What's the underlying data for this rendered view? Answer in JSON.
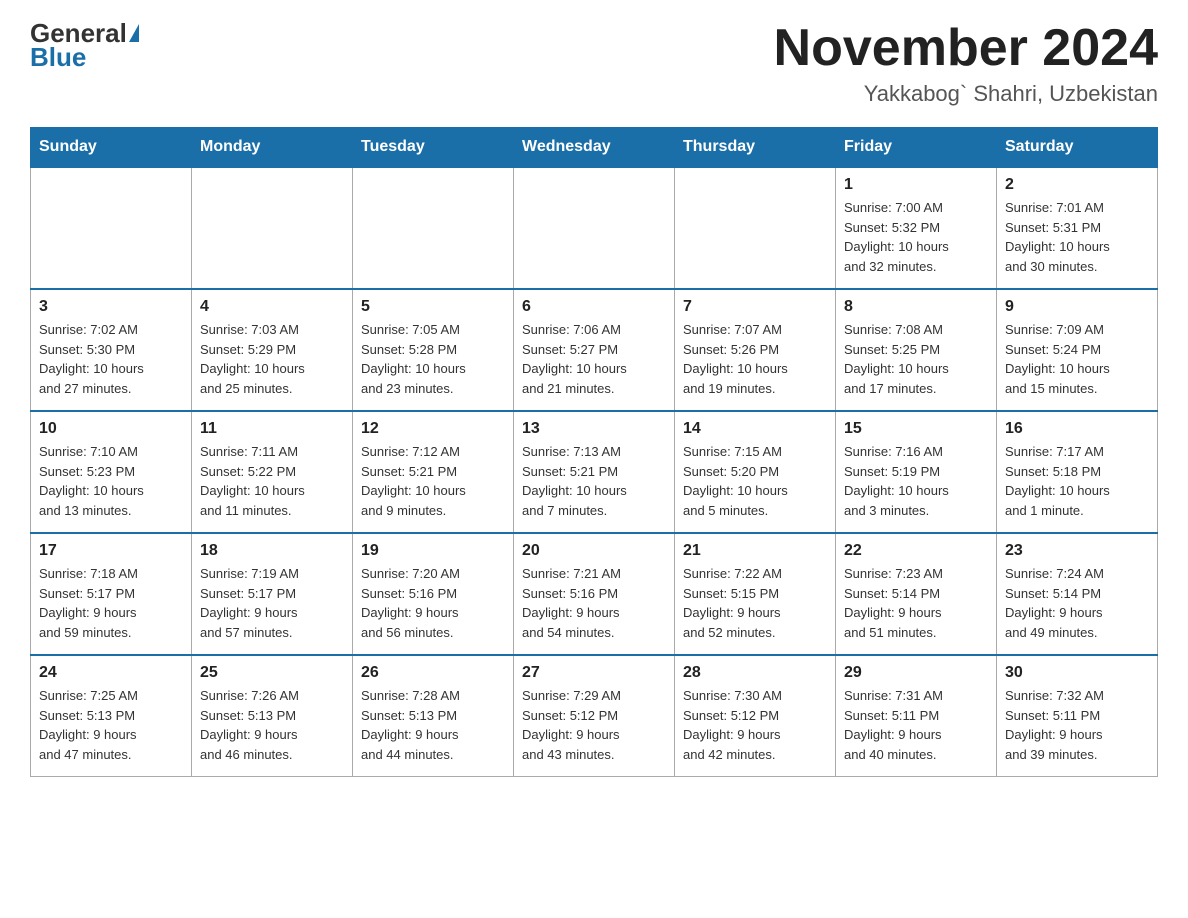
{
  "header": {
    "logo_general": "General",
    "logo_blue": "Blue",
    "month_title": "November 2024",
    "location": "Yakkabog` Shahri, Uzbekistan"
  },
  "weekdays": [
    "Sunday",
    "Monday",
    "Tuesday",
    "Wednesday",
    "Thursday",
    "Friday",
    "Saturday"
  ],
  "weeks": [
    [
      {
        "day": "",
        "info": ""
      },
      {
        "day": "",
        "info": ""
      },
      {
        "day": "",
        "info": ""
      },
      {
        "day": "",
        "info": ""
      },
      {
        "day": "",
        "info": ""
      },
      {
        "day": "1",
        "info": "Sunrise: 7:00 AM\nSunset: 5:32 PM\nDaylight: 10 hours\nand 32 minutes."
      },
      {
        "day": "2",
        "info": "Sunrise: 7:01 AM\nSunset: 5:31 PM\nDaylight: 10 hours\nand 30 minutes."
      }
    ],
    [
      {
        "day": "3",
        "info": "Sunrise: 7:02 AM\nSunset: 5:30 PM\nDaylight: 10 hours\nand 27 minutes."
      },
      {
        "day": "4",
        "info": "Sunrise: 7:03 AM\nSunset: 5:29 PM\nDaylight: 10 hours\nand 25 minutes."
      },
      {
        "day": "5",
        "info": "Sunrise: 7:05 AM\nSunset: 5:28 PM\nDaylight: 10 hours\nand 23 minutes."
      },
      {
        "day": "6",
        "info": "Sunrise: 7:06 AM\nSunset: 5:27 PM\nDaylight: 10 hours\nand 21 minutes."
      },
      {
        "day": "7",
        "info": "Sunrise: 7:07 AM\nSunset: 5:26 PM\nDaylight: 10 hours\nand 19 minutes."
      },
      {
        "day": "8",
        "info": "Sunrise: 7:08 AM\nSunset: 5:25 PM\nDaylight: 10 hours\nand 17 minutes."
      },
      {
        "day": "9",
        "info": "Sunrise: 7:09 AM\nSunset: 5:24 PM\nDaylight: 10 hours\nand 15 minutes."
      }
    ],
    [
      {
        "day": "10",
        "info": "Sunrise: 7:10 AM\nSunset: 5:23 PM\nDaylight: 10 hours\nand 13 minutes."
      },
      {
        "day": "11",
        "info": "Sunrise: 7:11 AM\nSunset: 5:22 PM\nDaylight: 10 hours\nand 11 minutes."
      },
      {
        "day": "12",
        "info": "Sunrise: 7:12 AM\nSunset: 5:21 PM\nDaylight: 10 hours\nand 9 minutes."
      },
      {
        "day": "13",
        "info": "Sunrise: 7:13 AM\nSunset: 5:21 PM\nDaylight: 10 hours\nand 7 minutes."
      },
      {
        "day": "14",
        "info": "Sunrise: 7:15 AM\nSunset: 5:20 PM\nDaylight: 10 hours\nand 5 minutes."
      },
      {
        "day": "15",
        "info": "Sunrise: 7:16 AM\nSunset: 5:19 PM\nDaylight: 10 hours\nand 3 minutes."
      },
      {
        "day": "16",
        "info": "Sunrise: 7:17 AM\nSunset: 5:18 PM\nDaylight: 10 hours\nand 1 minute."
      }
    ],
    [
      {
        "day": "17",
        "info": "Sunrise: 7:18 AM\nSunset: 5:17 PM\nDaylight: 9 hours\nand 59 minutes."
      },
      {
        "day": "18",
        "info": "Sunrise: 7:19 AM\nSunset: 5:17 PM\nDaylight: 9 hours\nand 57 minutes."
      },
      {
        "day": "19",
        "info": "Sunrise: 7:20 AM\nSunset: 5:16 PM\nDaylight: 9 hours\nand 56 minutes."
      },
      {
        "day": "20",
        "info": "Sunrise: 7:21 AM\nSunset: 5:16 PM\nDaylight: 9 hours\nand 54 minutes."
      },
      {
        "day": "21",
        "info": "Sunrise: 7:22 AM\nSunset: 5:15 PM\nDaylight: 9 hours\nand 52 minutes."
      },
      {
        "day": "22",
        "info": "Sunrise: 7:23 AM\nSunset: 5:14 PM\nDaylight: 9 hours\nand 51 minutes."
      },
      {
        "day": "23",
        "info": "Sunrise: 7:24 AM\nSunset: 5:14 PM\nDaylight: 9 hours\nand 49 minutes."
      }
    ],
    [
      {
        "day": "24",
        "info": "Sunrise: 7:25 AM\nSunset: 5:13 PM\nDaylight: 9 hours\nand 47 minutes."
      },
      {
        "day": "25",
        "info": "Sunrise: 7:26 AM\nSunset: 5:13 PM\nDaylight: 9 hours\nand 46 minutes."
      },
      {
        "day": "26",
        "info": "Sunrise: 7:28 AM\nSunset: 5:13 PM\nDaylight: 9 hours\nand 44 minutes."
      },
      {
        "day": "27",
        "info": "Sunrise: 7:29 AM\nSunset: 5:12 PM\nDaylight: 9 hours\nand 43 minutes."
      },
      {
        "day": "28",
        "info": "Sunrise: 7:30 AM\nSunset: 5:12 PM\nDaylight: 9 hours\nand 42 minutes."
      },
      {
        "day": "29",
        "info": "Sunrise: 7:31 AM\nSunset: 5:11 PM\nDaylight: 9 hours\nand 40 minutes."
      },
      {
        "day": "30",
        "info": "Sunrise: 7:32 AM\nSunset: 5:11 PM\nDaylight: 9 hours\nand 39 minutes."
      }
    ]
  ]
}
